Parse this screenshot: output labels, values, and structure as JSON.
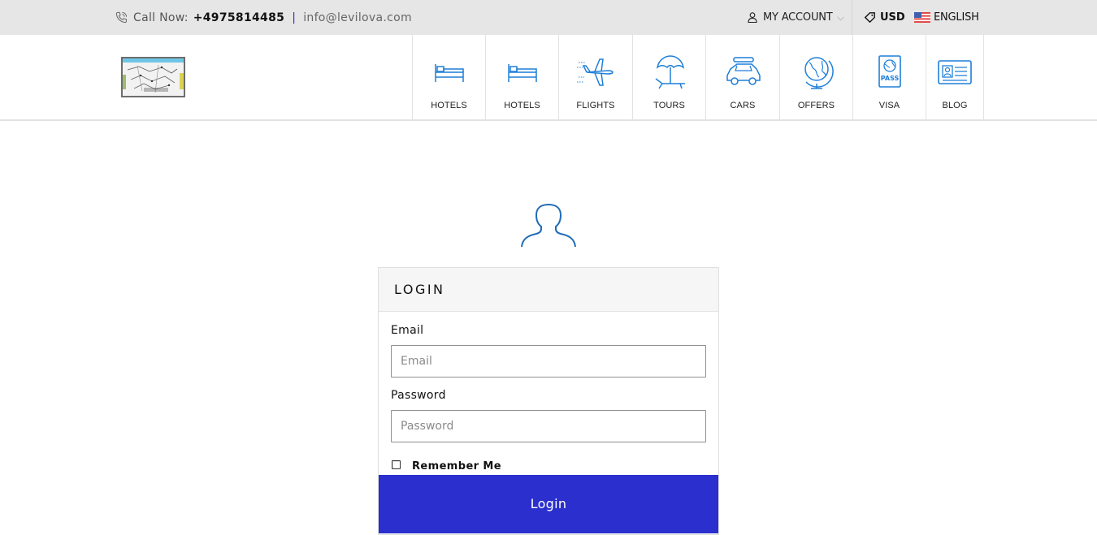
{
  "topbar": {
    "call_label": "Call Now:",
    "phone": "+4975814485",
    "separator": "|",
    "email": "info@levilova.com",
    "account_label": "MY ACCOUNT",
    "currency": "USD",
    "language": "ENGLISH"
  },
  "nav": {
    "items": [
      {
        "label": "HOTELS",
        "icon": "bed-icon"
      },
      {
        "label": "HOTELS",
        "icon": "bed-icon"
      },
      {
        "label": "FLIGHTS",
        "icon": "airplane-icon"
      },
      {
        "label": "TOURS",
        "icon": "beach-umbrella-icon"
      },
      {
        "label": "CARS",
        "icon": "car-icon"
      },
      {
        "label": "OFFERS",
        "icon": "globe-icon"
      },
      {
        "label": "VISA",
        "icon": "passport-icon"
      },
      {
        "label": "BLOG",
        "icon": "id-card-icon"
      }
    ]
  },
  "login": {
    "title": "LOGIN",
    "email_label": "Email",
    "email_placeholder": "Email",
    "password_label": "Password",
    "password_placeholder": "Password",
    "remember_label": "Remember Me",
    "remember_checked": false,
    "submit_label": "Login"
  },
  "colors": {
    "accent": "#2a2fcd",
    "icon_blue": "#1f7fd8",
    "topbar_bg": "#e6e6e6"
  }
}
